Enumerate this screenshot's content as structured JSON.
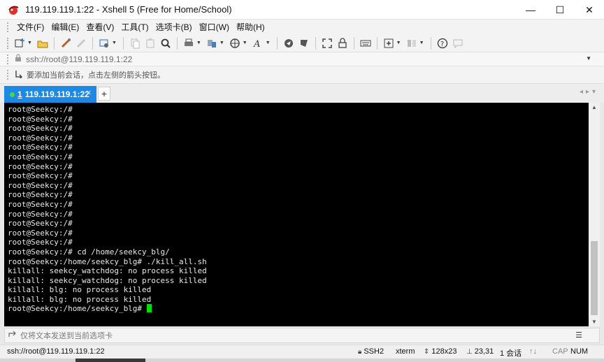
{
  "window": {
    "title": "119.119.119.1:22 - Xshell 5 (Free for Home/School)",
    "minimize": "—",
    "maximize": "☐",
    "close": "✕"
  },
  "menu": [
    "文件(F)",
    "编辑(E)",
    "查看(V)",
    "工具(T)",
    "选项卡(B)",
    "窗口(W)",
    "帮助(H)"
  ],
  "toolbar": {
    "icons": [
      "new-session-icon",
      "open-icon",
      "reconnect-icon",
      "disconnect-icon",
      "properties-icon",
      "copy-icon",
      "paste-icon",
      "find-icon",
      "print-icon",
      "transfer-icon",
      "web-icon",
      "font-icon",
      "xftp-icon",
      "xmanager-icon",
      "fullscreen-icon",
      "lock-icon",
      "keyboard-icon",
      "compose-icon",
      "layout-icon",
      "help-icon",
      "chat-icon"
    ]
  },
  "address": {
    "value": "ssh://root@119.119.119.1:22"
  },
  "hint": {
    "text": "要添加当前会话，点击左侧的箭头按钮。"
  },
  "tabs": [
    {
      "number": "1",
      "label": "119.119.119.1:22",
      "active": true
    }
  ],
  "terminal": {
    "lines": [
      "root@Seekcy:/#",
      "root@Seekcy:/#",
      "root@Seekcy:/#",
      "root@Seekcy:/#",
      "root@Seekcy:/#",
      "root@Seekcy:/#",
      "root@Seekcy:/#",
      "root@Seekcy:/#",
      "root@Seekcy:/#",
      "root@Seekcy:/#",
      "root@Seekcy:/#",
      "root@Seekcy:/#",
      "root@Seekcy:/#",
      "root@Seekcy:/#",
      "root@Seekcy:/#",
      "root@Seekcy:/# cd /home/seekcy_blg/",
      "root@Seekcy:/home/seekcy_blg# ./kill_all.sh",
      "killall: seekcy_watchdog: no process killed",
      "killall: seekcy_watchdog: no process killed",
      "killall: blg: no process killed",
      "killall: blg: no process killed"
    ],
    "prompt": "root@Seekcy:/home/seekcy_blg# ",
    "background": "#000000",
    "foreground": "#e8e8e8",
    "cursor_color": "#00e000"
  },
  "sendbar": {
    "text": "仅将文本发送到当前选项卡"
  },
  "status": {
    "connection": "ssh://root@119.119.119.1:22",
    "protocol": "SSH2",
    "terminal_type": "xterm",
    "size": "128x23",
    "position": "23,31",
    "sessions": "1 会话",
    "caps": "CAP",
    "num": "NUM"
  },
  "colors": {
    "tab_active": "#1e88e5",
    "tab_dot": "#44d844"
  }
}
